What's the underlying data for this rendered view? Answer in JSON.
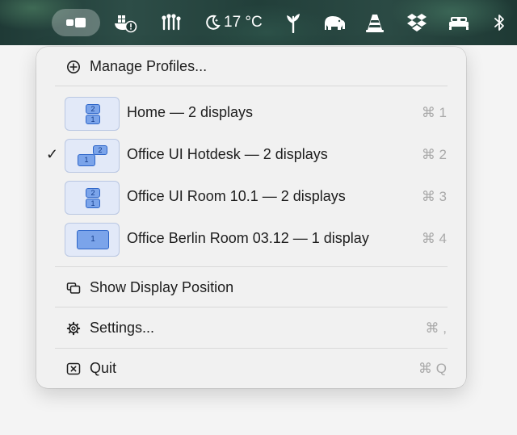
{
  "menubar": {
    "items": [
      {
        "name": "display-profiles-icon"
      },
      {
        "name": "docker-warning-icon"
      },
      {
        "name": "hand-fingers-icon"
      },
      {
        "name": "weather-moon-icon",
        "text": "17 °C"
      },
      {
        "name": "leaf-sprout-icon"
      },
      {
        "name": "elephant-icon"
      },
      {
        "name": "vlc-cone-icon"
      },
      {
        "name": "dropbox-icon"
      },
      {
        "name": "bed-icon"
      },
      {
        "name": "bluetooth-icon"
      }
    ],
    "weather_text": "17 °C"
  },
  "menu": {
    "manage_profiles": "Manage Profiles...",
    "profiles": [
      {
        "name": "Home",
        "detail": "2 displays",
        "shortcut": "⌘ 1",
        "checked": false,
        "thumb": "stacked"
      },
      {
        "name": "Office UI Hotdesk",
        "detail": "2 displays",
        "shortcut": "⌘ 2",
        "checked": true,
        "thumb": "offset"
      },
      {
        "name": "Office UI Room 10.1",
        "detail": "2 displays",
        "shortcut": "⌘ 3",
        "checked": false,
        "thumb": "stacked"
      },
      {
        "name": "Office Berlin Room 03.12",
        "detail": "1 display",
        "shortcut": "⌘ 4",
        "checked": false,
        "thumb": "single"
      }
    ],
    "profile_labels": [
      "Home  —  2 displays",
      "Office UI Hotdesk  —  2 displays",
      "Office UI Room 10.1  —  2 displays",
      "Office Berlin Room 03.12  —  1 display"
    ],
    "check_mark": "✓",
    "show_display_position": "Show Display Position",
    "settings": "Settings...",
    "settings_shortcut": "⌘ ,",
    "quit": "Quit",
    "quit_shortcut": "⌘ Q",
    "display_numbers": {
      "one": "1",
      "two": "2"
    }
  }
}
